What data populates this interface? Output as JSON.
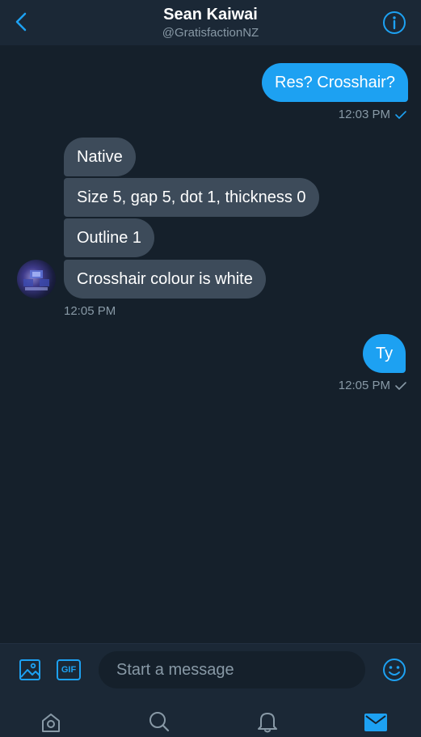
{
  "header": {
    "name": "Sean Kaiwai",
    "handle": "@GratisfactionNZ",
    "back_icon": "chevron-left-icon",
    "info_icon": "info-icon"
  },
  "colors": {
    "background": "#15202b",
    "bar": "#1b2836",
    "accent": "#1da1f2",
    "incoming_bubble": "#3d4b5a",
    "muted_text": "#8899a6"
  },
  "messages": [
    {
      "direction": "outgoing",
      "text": "Res? Crosshair?"
    },
    {
      "direction": "incoming",
      "text": "Native"
    },
    {
      "direction": "incoming",
      "text": "Size 5, gap 5, dot 1, thickness 0"
    },
    {
      "direction": "incoming",
      "text": "Outline 1"
    },
    {
      "direction": "incoming",
      "text": "Crosshair colour is white"
    },
    {
      "direction": "outgoing",
      "text": "Ty"
    }
  ],
  "timestamps": {
    "first_outgoing": "12:03 PM",
    "incoming_group": "12:05 PM",
    "second_outgoing": "12:05 PM"
  },
  "composer": {
    "placeholder": "Start a message",
    "image_icon": "image-icon",
    "gif_icon": "gif-icon",
    "gif_label": "GIF",
    "emoji_icon": "emoji-icon"
  },
  "tabbar": {
    "items": [
      "home-icon",
      "search-icon",
      "notifications-icon",
      "messages-icon"
    ],
    "active": "messages-icon"
  }
}
